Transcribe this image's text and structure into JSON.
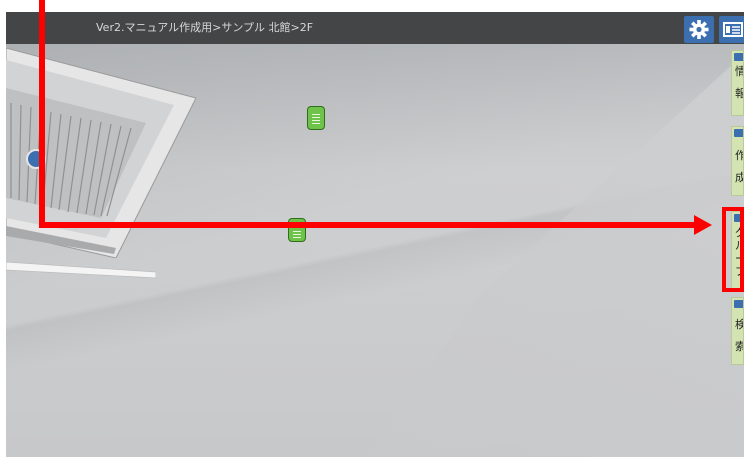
{
  "breadcrumb": "Ver2.マニュアル作成用>サンプル 北館>2F",
  "toolbar": {
    "settings_icon": "gear-icon",
    "panel_icon": "panel-toggle-icon",
    "button_color": "#3b6fb0"
  },
  "side_menu": {
    "items": [
      {
        "icon": "info-icon",
        "line1": "情",
        "line2": "報"
      },
      {
        "icon": "create-icon",
        "line1": "作",
        "line2": "成"
      },
      {
        "icon": "group-icon",
        "line1": "グ",
        "line2": "ル",
        "line3": "ー",
        "line4": "プ"
      },
      {
        "icon": "search-icon",
        "line1": "検",
        "line2": "索"
      }
    ],
    "background": "#d3e3b2"
  },
  "markers": [
    {
      "icon": "document-marker-icon"
    },
    {
      "icon": "document-marker-icon"
    }
  ],
  "annotation_color": "#ff0000"
}
